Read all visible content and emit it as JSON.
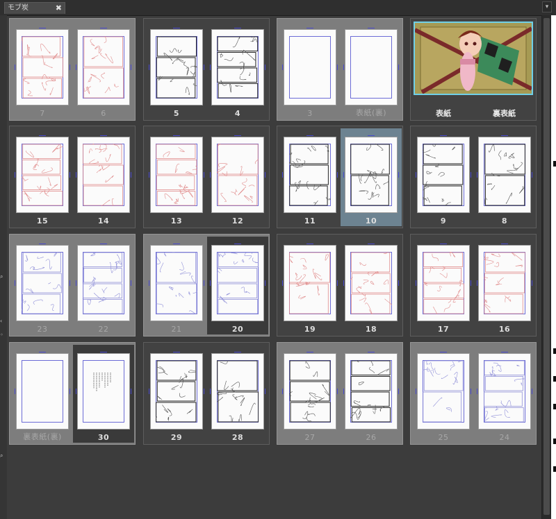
{
  "window": {
    "tab_label": "モブ炭",
    "close_glyph": "✖",
    "menu_glyph": "▾"
  },
  "colors": {
    "panel_bg": "#3c3c3c",
    "spread_light": "#7d7d7d",
    "spread_dark": "#4a4a4a",
    "selected_page": "#6d8391",
    "cover_frame": "#6fd0e8",
    "sketch_red": "#e08a8a",
    "sketch_blue": "#8f8fd8",
    "guide_blue": "#6b6bd6"
  },
  "spreads": [
    {
      "row": 0,
      "col": 0,
      "tone": "light",
      "pages": [
        {
          "label": "7",
          "sketch": "red",
          "dim": true
        },
        {
          "label": "6",
          "sketch": "red",
          "dim": true
        }
      ]
    },
    {
      "row": 0,
      "col": 1,
      "tone": "dark",
      "pages": [
        {
          "label": "5",
          "sketch": "black",
          "dim": false
        },
        {
          "label": "4",
          "sketch": "black",
          "dim": false
        }
      ]
    },
    {
      "row": 0,
      "col": 2,
      "tone": "light",
      "pages": [
        {
          "label": "3",
          "sketch": "none",
          "dim": true
        },
        {
          "label": "表紙(裏)",
          "sketch": "none",
          "dim": true
        }
      ]
    },
    {
      "row": 0,
      "col": 3,
      "tone": "cover",
      "pages": [
        {
          "label": "表紙"
        },
        {
          "label": "裏表紙"
        }
      ]
    },
    {
      "row": 1,
      "col": 0,
      "tone": "dark",
      "pages": [
        {
          "label": "15",
          "sketch": "red",
          "dim": false
        },
        {
          "label": "14",
          "sketch": "red",
          "dim": false
        }
      ]
    },
    {
      "row": 1,
      "col": 1,
      "tone": "dark",
      "pages": [
        {
          "label": "13",
          "sketch": "red",
          "dim": false
        },
        {
          "label": "12",
          "sketch": "red",
          "dim": false
        }
      ]
    },
    {
      "row": 1,
      "col": 2,
      "tone": "dark",
      "pages": [
        {
          "label": "11",
          "sketch": "black",
          "dim": false
        },
        {
          "label": "10",
          "sketch": "black",
          "dim": false,
          "selected": true
        }
      ]
    },
    {
      "row": 1,
      "col": 3,
      "tone": "dark",
      "pages": [
        {
          "label": "9",
          "sketch": "black",
          "dim": false
        },
        {
          "label": "8",
          "sketch": "black",
          "dim": false
        }
      ]
    },
    {
      "row": 2,
      "col": 0,
      "tone": "light",
      "pages": [
        {
          "label": "23",
          "sketch": "blue",
          "dim": true
        },
        {
          "label": "22",
          "sketch": "blue",
          "dim": true
        }
      ]
    },
    {
      "row": 2,
      "col": 1,
      "tone": "light",
      "pages": [
        {
          "label": "21",
          "sketch": "blue",
          "dim": true
        },
        {
          "label": "20",
          "sketch": "blue",
          "dim": false,
          "dark": true
        }
      ]
    },
    {
      "row": 2,
      "col": 2,
      "tone": "dark",
      "pages": [
        {
          "label": "19",
          "sketch": "red",
          "dim": false
        },
        {
          "label": "18",
          "sketch": "red",
          "dim": false
        }
      ]
    },
    {
      "row": 2,
      "col": 3,
      "tone": "dark",
      "pages": [
        {
          "label": "17",
          "sketch": "red",
          "dim": false
        },
        {
          "label": "16",
          "sketch": "red",
          "dim": false
        }
      ]
    },
    {
      "row": 3,
      "col": 0,
      "tone": "light",
      "pages": [
        {
          "label": "裏表紙(裏)",
          "sketch": "none",
          "dim": true
        },
        {
          "label": "30",
          "sketch": "text",
          "dim": false,
          "dark": true
        }
      ]
    },
    {
      "row": 3,
      "col": 1,
      "tone": "dark",
      "pages": [
        {
          "label": "29",
          "sketch": "black",
          "dim": false
        },
        {
          "label": "28",
          "sketch": "black",
          "dim": false
        }
      ]
    },
    {
      "row": 3,
      "col": 2,
      "tone": "light",
      "pages": [
        {
          "label": "27",
          "sketch": "black",
          "dim": true
        },
        {
          "label": "26",
          "sketch": "black",
          "dim": true
        }
      ]
    },
    {
      "row": 3,
      "col": 3,
      "tone": "light",
      "pages": [
        {
          "label": "25",
          "sketch": "blue",
          "dim": true
        },
        {
          "label": "24",
          "sketch": "blue",
          "dim": true
        }
      ]
    }
  ]
}
